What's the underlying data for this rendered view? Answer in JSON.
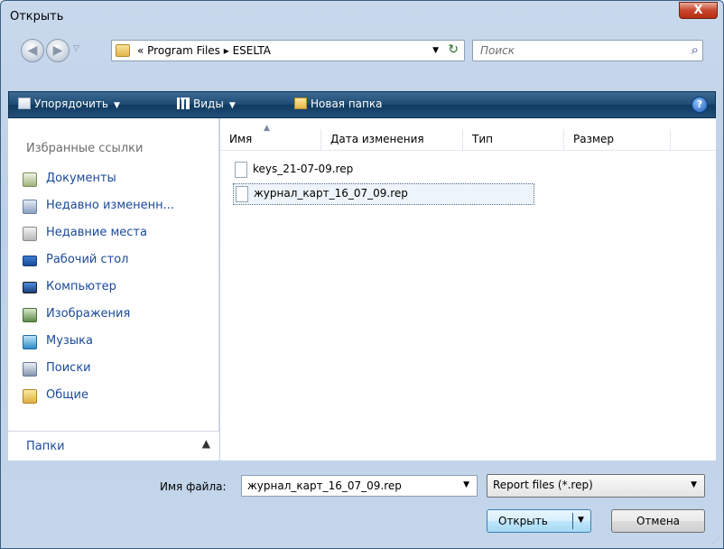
{
  "window": {
    "title": "Открыть",
    "close_glyph": "X"
  },
  "nav": {
    "breadcrumb": "« Program Files ▸ ESELTA",
    "search_placeholder": "Поиск"
  },
  "toolbar": {
    "organize": "Упорядочить",
    "views": "Виды",
    "new_folder": "Новая папка",
    "help": "?"
  },
  "sidebar": {
    "favorites_title": "Избранные ссылки",
    "items": [
      {
        "label": "Документы",
        "icon": "documents-icon"
      },
      {
        "label": "Недавно измененн...",
        "icon": "recent-changed-icon"
      },
      {
        "label": "Недавние места",
        "icon": "recent-places-icon"
      },
      {
        "label": "Рабочий стол",
        "icon": "desktop-icon"
      },
      {
        "label": "Компьютер",
        "icon": "computer-icon"
      },
      {
        "label": "Изображения",
        "icon": "pictures-icon"
      },
      {
        "label": "Музыка",
        "icon": "music-icon"
      },
      {
        "label": "Поиски",
        "icon": "searches-icon"
      },
      {
        "label": "Общие",
        "icon": "public-folder-icon"
      }
    ],
    "folders_label": "Папки"
  },
  "files": {
    "columns": [
      "Имя",
      "Дата изменения",
      "Тип",
      "Размер"
    ],
    "rows": [
      {
        "name": "keys_21-07-09.rep"
      },
      {
        "name": "журнал_карт_16_07_09.rep"
      }
    ]
  },
  "footer": {
    "filename_label": "Имя файла:",
    "filename_value": "журнал_карт_16_07_09.rep",
    "filter_value": "Report files (*.rep)",
    "open_label": "Открыть",
    "cancel_label": "Отмена"
  }
}
